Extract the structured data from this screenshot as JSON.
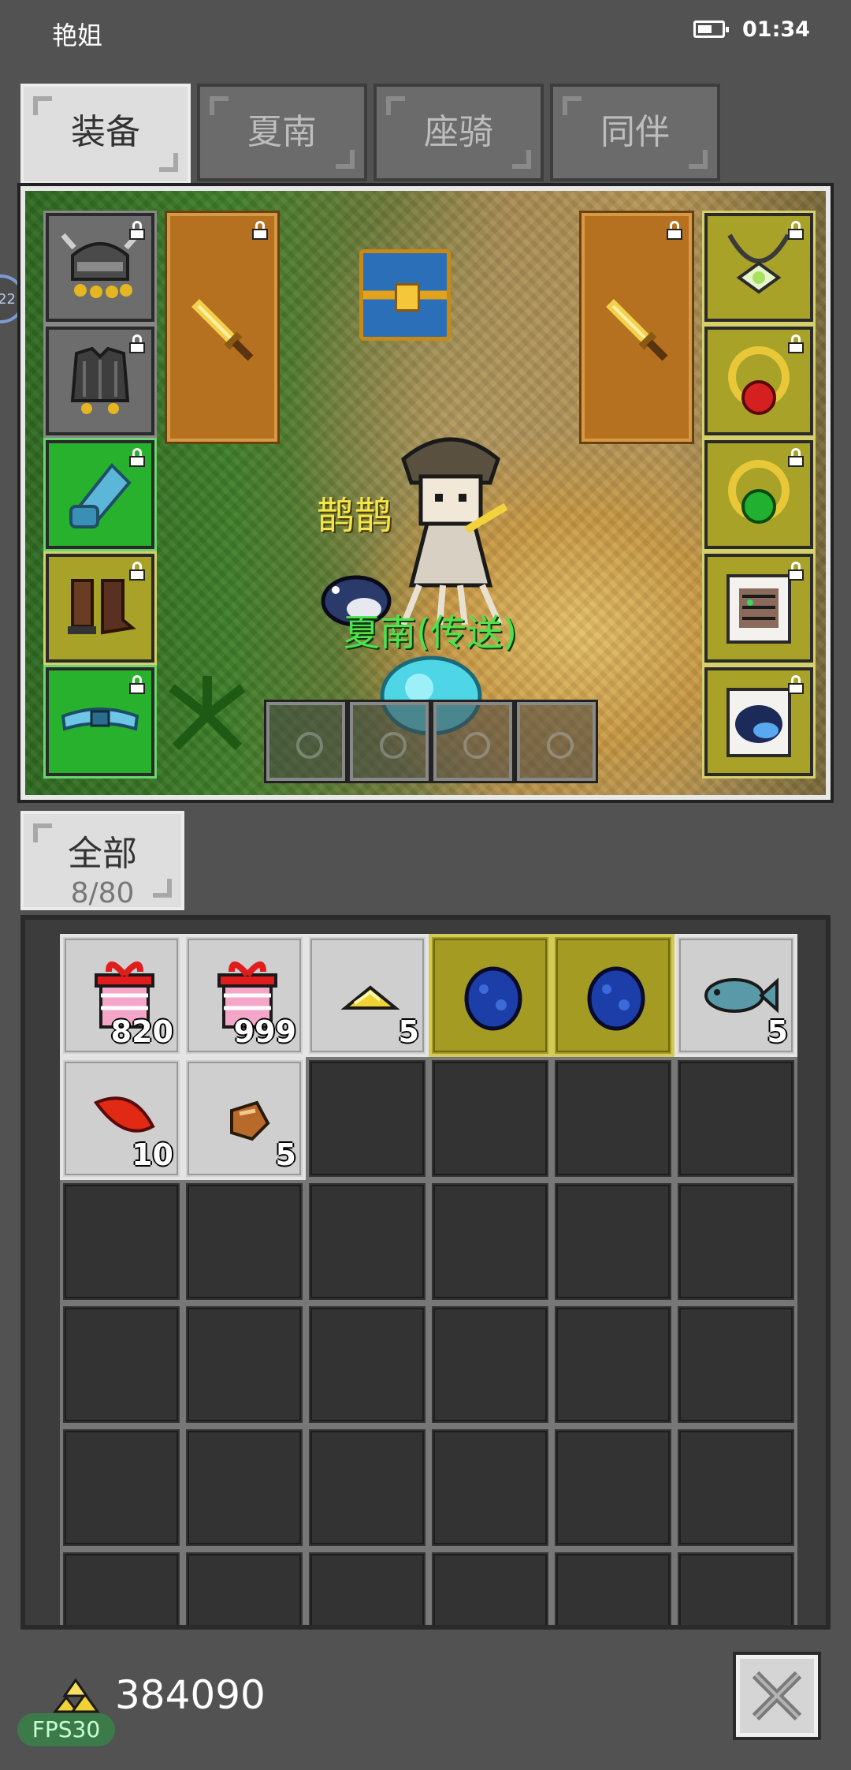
{
  "status_bar": {
    "name": "艳姐",
    "time": "01:34",
    "battery_level": 0.6
  },
  "side_badge": "22",
  "tabs": [
    {
      "label": "装备",
      "active": true
    },
    {
      "label": "夏南",
      "active": false
    },
    {
      "label": "座骑",
      "active": false
    },
    {
      "label": "同伴",
      "active": false
    }
  ],
  "scene": {
    "character_name": "鹊鹊",
    "pet_name": "夏南(传送)",
    "left_slots": [
      {
        "icon": "helmet-icon",
        "color": "gray",
        "locked": true
      },
      {
        "icon": "armor-icon",
        "color": "gray",
        "locked": true
      },
      {
        "icon": "gauntlet-icon",
        "color": "green",
        "locked": true
      },
      {
        "icon": "boots-icon",
        "color": "olive",
        "locked": true
      },
      {
        "icon": "belt-icon",
        "color": "green",
        "locked": true
      }
    ],
    "right_slots": [
      {
        "icon": "necklace-icon",
        "color": "olive",
        "locked": true
      },
      {
        "icon": "red-ring-icon",
        "color": "olive",
        "locked": true
      },
      {
        "icon": "green-ring-icon",
        "color": "olive",
        "locked": true
      },
      {
        "icon": "tiger-card-icon",
        "color": "olive",
        "locked": true
      },
      {
        "icon": "bird-card-icon",
        "color": "olive",
        "locked": true
      }
    ],
    "weapon_slots": [
      {
        "icon": "sword-icon",
        "locked": true
      },
      {
        "icon": "sword-icon",
        "locked": true
      }
    ]
  },
  "bag": {
    "tab_label": "全部",
    "count": "8/80"
  },
  "inventory": [
    {
      "icon": "gift-box-icon",
      "qty": "820",
      "bg": "filled"
    },
    {
      "icon": "gift-box-icon",
      "qty": "999",
      "bg": "filled"
    },
    {
      "icon": "gold-nugget-icon",
      "qty": "5",
      "bg": "filled"
    },
    {
      "icon": "blue-egg-icon",
      "qty": "",
      "bg": "yellow"
    },
    {
      "icon": "blue-egg-icon",
      "qty": "",
      "bg": "yellow"
    },
    {
      "icon": "fish-icon",
      "qty": "5",
      "bg": "filled"
    },
    {
      "icon": "red-leaf-icon",
      "qty": "10",
      "bg": "filled"
    },
    {
      "icon": "ore-icon",
      "qty": "5",
      "bg": "filled"
    }
  ],
  "footer": {
    "gold": "384090",
    "fps": "FPS30"
  }
}
